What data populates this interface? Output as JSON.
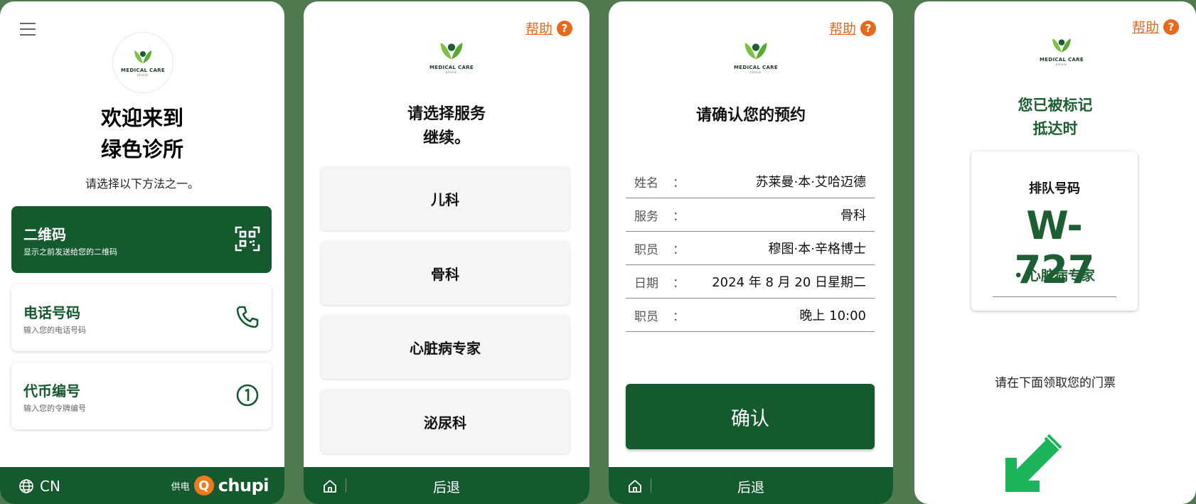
{
  "screen1": {
    "menu_icon": "hamburger-menu-icon",
    "logo": {
      "text": "MEDICAL CARE",
      "sub": "clinic"
    },
    "welcome_line1": "欢迎来到",
    "welcome_line2": "绿色诊所",
    "subtitle": "请选择以下方法之一。",
    "methods": [
      {
        "title": "二维码",
        "desc": "显示之前发送给您的二维码",
        "icon": "qr-code-icon"
      },
      {
        "title": "电话号码",
        "desc": "输入您的电话号码",
        "icon": "phone-icon"
      },
      {
        "title": "代币编号",
        "desc": "输入您的令牌编号",
        "icon": "token-number-icon"
      }
    ],
    "language": "CN",
    "powered_label": "供电",
    "brand": "chupi"
  },
  "screen2": {
    "help_label": "帮助",
    "help_icon": "?",
    "logo": {
      "text": "MEDICAL CARE",
      "sub": "clinic"
    },
    "heading_line1": "请选择服务",
    "heading_line2": "继续。",
    "services": [
      "儿科",
      "骨科",
      "心脏病专家",
      "泌尿科"
    ],
    "back_label": "后退"
  },
  "screen3": {
    "help_label": "帮助",
    "help_icon": "?",
    "logo": {
      "text": "MEDICAL CARE",
      "sub": "clinic"
    },
    "heading": "请确认您的预约",
    "rows": [
      {
        "label": "姓名",
        "value": "苏莱曼·本·艾哈迈德"
      },
      {
        "label": "服务",
        "value": "骨科"
      },
      {
        "label": "职员",
        "value": "穆图·本·辛格博士"
      },
      {
        "label": "日期",
        "value": "2024 年 8 月 20 日星期二"
      },
      {
        "label": "职员",
        "value": "晚上 10:00"
      }
    ],
    "colon": "：",
    "confirm_label": "确认",
    "back_label": "后退"
  },
  "screen4": {
    "help_label": "帮助",
    "help_icon": "?",
    "logo": {
      "text": "MEDICAL CARE",
      "sub": "clinic"
    },
    "marked_line1": "您已被标记",
    "marked_line2": "抵达时",
    "queue_label": "排队号码",
    "queue_number": "W-727",
    "queue_service": "• 心脏病专家",
    "ticket_text": "请在下面领取您的门票",
    "arrow_icon": "arrow-down-left-icon"
  },
  "colors": {
    "primary_green": "#15592f",
    "accent_orange": "#e8691b",
    "arrow_green": "#1db55c"
  }
}
